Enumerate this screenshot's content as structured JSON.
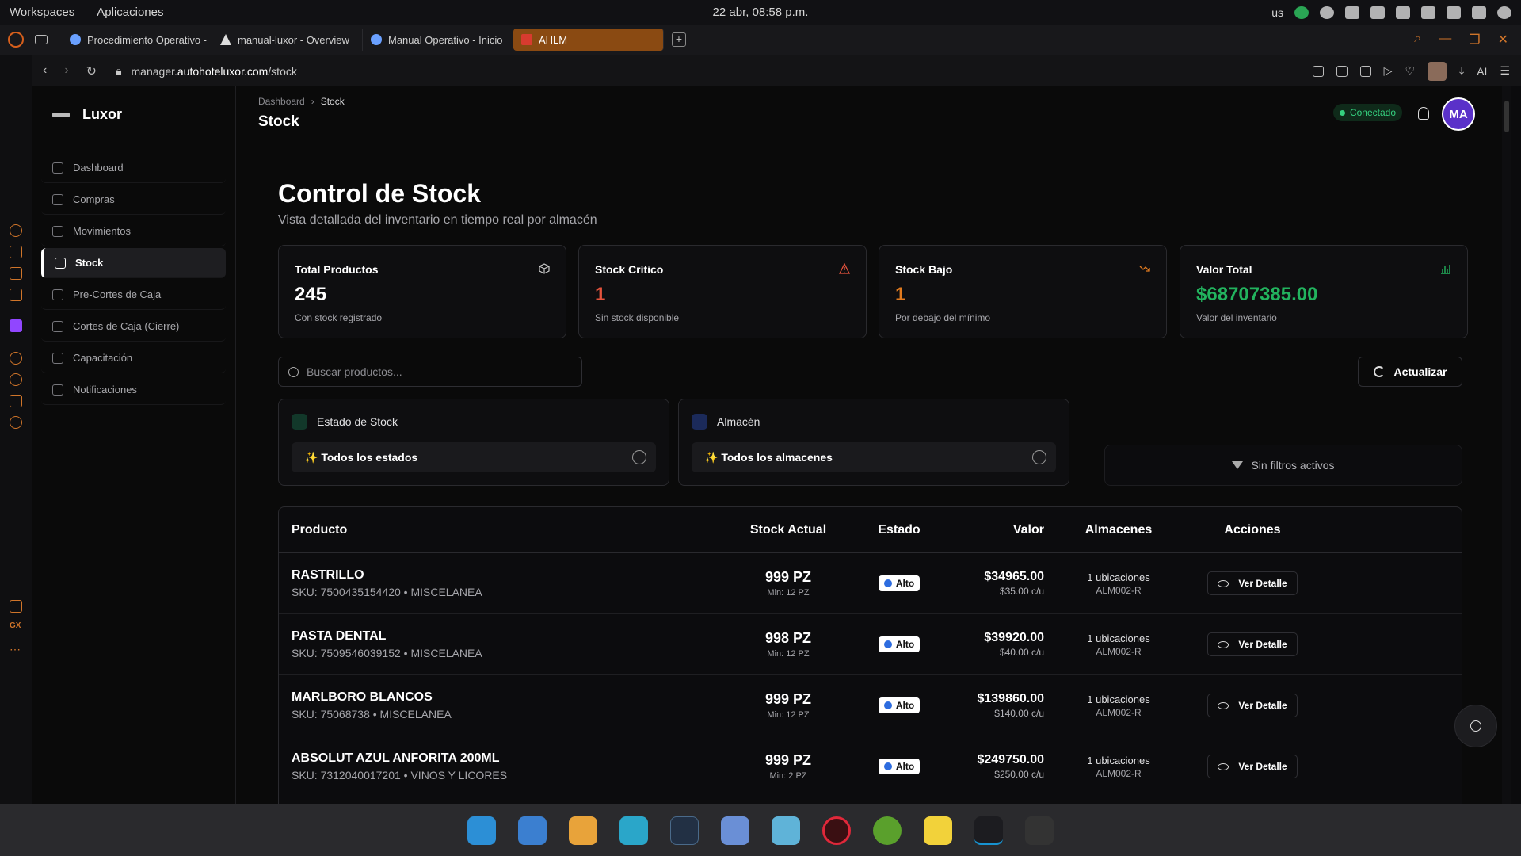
{
  "os": {
    "menu": [
      "Workspaces",
      "Aplicaciones"
    ],
    "clock": "22 abr, 08:58 p.m.",
    "lang": "us"
  },
  "browser": {
    "tabs": [
      {
        "label": "Procedimiento Operativo -"
      },
      {
        "label": "manual-luxor - Overview"
      },
      {
        "label": "Manual Operativo - Inicio"
      },
      {
        "label": "AHLM"
      }
    ],
    "url_prefix": "manager.",
    "url_domain": "autohoteluxor.com",
    "url_path": "/stock",
    "ai_label": "AI"
  },
  "app": {
    "brand": "Luxor",
    "nav": [
      {
        "label": "Dashboard"
      },
      {
        "label": "Compras"
      },
      {
        "label": "Movimientos"
      },
      {
        "label": "Stock"
      },
      {
        "label": "Pre-Cortes de Caja"
      },
      {
        "label": "Cortes de Caja (Cierre)"
      },
      {
        "label": "Capacitación"
      },
      {
        "label": "Notificaciones"
      }
    ],
    "breadcrumb": {
      "root": "Dashboard",
      "sep": "›",
      "current": "Stock"
    },
    "page_title": "Stock",
    "status": "Conectado",
    "avatar": "MA"
  },
  "main": {
    "title": "Control de Stock",
    "subtitle": "Vista detallada del inventario en tiempo real por almacén",
    "cards": [
      {
        "title": "Total Productos",
        "value": "245",
        "desc": "Con stock registrado",
        "color": "#ffffff"
      },
      {
        "title": "Stock Crítico",
        "value": "1",
        "desc": "Sin stock disponible",
        "color": "#e5533d"
      },
      {
        "title": "Stock Bajo",
        "value": "1",
        "desc": "Por debajo del mínimo",
        "color": "#e07a1f"
      },
      {
        "title": "Valor Total",
        "value": "$68707385.00",
        "desc": "Valor del inventario",
        "color": "#22b35e"
      }
    ],
    "search_placeholder": "Buscar productos...",
    "refresh_label": "Actualizar",
    "filters": [
      {
        "label": "Estado de Stock",
        "value": "✨ Todos los estados"
      },
      {
        "label": "Almacén",
        "value": "✨ Todos los almacenes"
      }
    ],
    "no_filters": "Sin filtros activos",
    "table": {
      "headers": [
        "Producto",
        "Stock Actual",
        "Estado",
        "Valor",
        "Almacenes",
        "Acciones"
      ],
      "rows": [
        {
          "name": "RASTRILLO",
          "sku": "SKU: 7500435154420 • MISCELANEA",
          "stock": "999 PZ",
          "min": "Min: 12 PZ",
          "status": "Alto",
          "value": "$34965.00",
          "unit": "$35.00 c/u",
          "loc": "1 ubicaciones",
          "code": "ALM002-R",
          "action": "Ver Detalle"
        },
        {
          "name": "PASTA DENTAL",
          "sku": "SKU: 7509546039152 • MISCELANEA",
          "stock": "998 PZ",
          "min": "Min: 12 PZ",
          "status": "Alto",
          "value": "$39920.00",
          "unit": "$40.00 c/u",
          "loc": "1 ubicaciones",
          "code": "ALM002-R",
          "action": "Ver Detalle"
        },
        {
          "name": "MARLBORO BLANCOS",
          "sku": "SKU: 75068738 • MISCELANEA",
          "stock": "999 PZ",
          "min": "Min: 12 PZ",
          "status": "Alto",
          "value": "$139860.00",
          "unit": "$140.00 c/u",
          "loc": "1 ubicaciones",
          "code": "ALM002-R",
          "action": "Ver Detalle"
        },
        {
          "name": "ABSOLUT AZUL ANFORITA 200ML",
          "sku": "SKU: 7312040017201 • VINOS Y LICORES",
          "stock": "999 PZ",
          "min": "Min: 2 PZ",
          "status": "Alto",
          "value": "$249750.00",
          "unit": "$250.00 c/u",
          "loc": "1 ubicaciones",
          "code": "ALM002-R",
          "action": "Ver Detalle"
        }
      ]
    }
  }
}
